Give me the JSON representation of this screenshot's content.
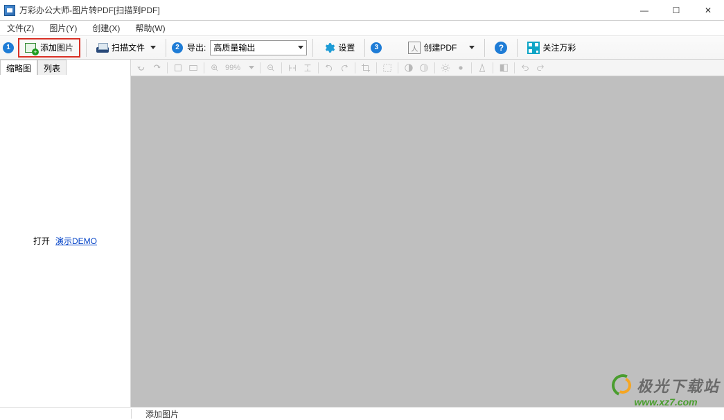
{
  "window": {
    "title": "万彩办公大师-图片转PDF[扫描到PDF]",
    "min": "—",
    "max": "☐",
    "close": "✕"
  },
  "menubar": {
    "file": "文件(Z)",
    "image": "图片(Y)",
    "create": "创建(X)",
    "help": "帮助(W)"
  },
  "toolbar": {
    "step1": "1",
    "add_image": "添加图片",
    "scan_file": "扫描文件",
    "step2": "2",
    "output_label": "导出:",
    "output_value": "高质量输出",
    "settings": "设置",
    "step3": "3",
    "create_pdf": "创建PDF",
    "follow": "关注万彩"
  },
  "sidepanel": {
    "tab_thumb": "缩略图",
    "tab_list": "列表",
    "open_label": "打开",
    "demo_link": "演示DEMO"
  },
  "imgtoolbar": {
    "zoom_pct": "99%"
  },
  "statusbar": {
    "msg": "添加图片"
  },
  "watermark": {
    "brand": "极光下载站",
    "url": "www.xz7.com"
  }
}
